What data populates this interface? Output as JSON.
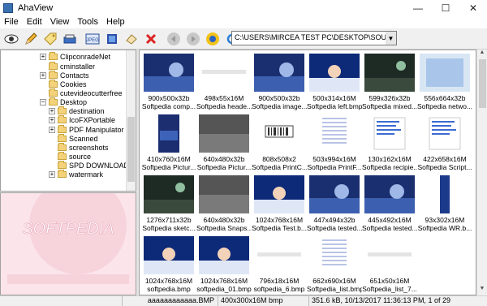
{
  "window": {
    "title": "AhaView",
    "minimize": "—",
    "maximize": "☐",
    "close": "✕"
  },
  "menu": [
    "File",
    "Edit",
    "View",
    "Tools",
    "Help"
  ],
  "toolbar": {
    "path": "C:\\USERS\\MIRCEA TEST PC\\DESKTOP\\SOURCE",
    "combo_arrow": "▼"
  },
  "tree": [
    {
      "label": "ClipconradeNet",
      "expander": "+"
    },
    {
      "label": "cminstaller",
      "expander": ""
    },
    {
      "label": "Contacts",
      "expander": "+"
    },
    {
      "label": "Cookies",
      "expander": ""
    },
    {
      "label": "cutevideocutterfree",
      "expander": ""
    },
    {
      "label": "Desktop",
      "expander": "−"
    },
    {
      "label": "destination",
      "expander": "+"
    },
    {
      "label": "IcoFXPortable",
      "expander": "+"
    },
    {
      "label": "PDF Manipulator DC",
      "expander": "+"
    },
    {
      "label": "Scanned",
      "expander": ""
    },
    {
      "label": "screenshots",
      "expander": ""
    },
    {
      "label": "source",
      "expander": ""
    },
    {
      "label": "SPD DOWNLOADS",
      "expander": ""
    },
    {
      "label": "watermark",
      "expander": "+"
    }
  ],
  "preview": {
    "watermark": "SOFTPEDIA"
  },
  "thumbnails": [
    {
      "dims": "900x500x32b",
      "name": "Softpedia comp...",
      "img": "blue"
    },
    {
      "dims": "498x55x16M",
      "name": "Softpedia heade...",
      "img": "white"
    },
    {
      "dims": "900x500x32b",
      "name": "Softpedia image...",
      "img": "blue"
    },
    {
      "dims": "500x314x16M",
      "name": "Softpedia left.bmp",
      "img": "angel"
    },
    {
      "dims": "599x326x32b",
      "name": "Softpedia mixed...",
      "img": "dark"
    },
    {
      "dims": "556x664x32b",
      "name": "Softpedia netwo...",
      "img": "light"
    },
    {
      "dims": "410x760x16M",
      "name": "Softpedia Pictur...",
      "img": "portrait"
    },
    {
      "dims": "640x480x32b",
      "name": "Softpedia Pictur...",
      "img": "gray"
    },
    {
      "dims": "808x508x2",
      "name": "Softpedia PrintC...",
      "img": "barcode"
    },
    {
      "dims": "503x994x16M",
      "name": "Softpedia PrintF...",
      "img": "list"
    },
    {
      "dims": "130x162x16M",
      "name": "Softpedia recipie...",
      "img": "doc"
    },
    {
      "dims": "422x658x16M",
      "name": "Softpedia Script...",
      "img": "doc"
    },
    {
      "dims": "1276x711x32b",
      "name": "Softpedia sketc...",
      "img": "dark"
    },
    {
      "dims": "640x480x32b",
      "name": "Softpedia Snaps...",
      "img": "gray"
    },
    {
      "dims": "1024x768x16M",
      "name": "Softpedia Test.b...",
      "img": "angel"
    },
    {
      "dims": "447x494x32b",
      "name": "Softpedia tested...",
      "img": "blue"
    },
    {
      "dims": "445x492x16M",
      "name": "Softpedia tested...",
      "img": "blue"
    },
    {
      "dims": "93x302x16M",
      "name": "Softpedia WR.b...",
      "img": "vertical"
    },
    {
      "dims": "1024x768x16M",
      "name": "softpedia.bmp",
      "img": "angel"
    },
    {
      "dims": "1024x768x16M",
      "name": "softpedia_01.bmp",
      "img": "angel"
    },
    {
      "dims": "796x18x16M",
      "name": "softpedia_6.bmp",
      "img": "white"
    },
    {
      "dims": "662x690x16M",
      "name": "Softpedia_list.bmp",
      "img": "list"
    },
    {
      "dims": "651x50x16M",
      "name": "Softpedia_list_7...",
      "img": "white"
    }
  ],
  "status": {
    "file": "aaaaaaaaaaaa.BMP",
    "info": "400x300x16M bmp",
    "size": "351.6 kB, 10/13/2017 11:36:13 PM, 1 of 29"
  },
  "colors": {
    "selection": "#7aa2d6",
    "preview_bg": "#fbe4ea"
  }
}
